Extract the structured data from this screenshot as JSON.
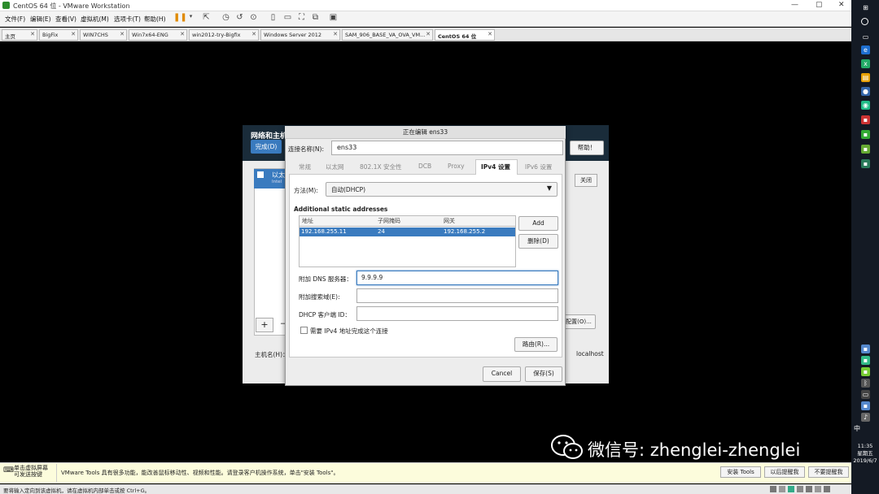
{
  "window": {
    "title": "CentOS 64 位 - VMware Workstation"
  },
  "menu": [
    "文件(F)",
    "编辑(E)",
    "查看(V)",
    "虚拟机(M)",
    "选项卡(T)",
    "帮助(H)"
  ],
  "tabs": [
    {
      "label": "主页",
      "active": false
    },
    {
      "label": "BigFix",
      "active": false
    },
    {
      "label": "WIN7CHS",
      "active": false
    },
    {
      "label": "Win7x64-ENG",
      "active": false
    },
    {
      "label": "win2012-try-Bigfix",
      "active": false
    },
    {
      "label": "Windows Server 2012",
      "active": false
    },
    {
      "label": "SAM_906_BASE_VA_OVA_VM...",
      "active": false
    },
    {
      "label": "CentOS 64 位",
      "active": true
    }
  ],
  "background_window": {
    "title": "网络和主机名",
    "done_label": "完成(D)",
    "help_label": "帮助！",
    "list_item": "以太",
    "list_item_sub": "Intel",
    "close_label": "关闭",
    "configure_label": "配置(O)...",
    "hostname_label": "主机名(H)：",
    "hostname_value": "localhost",
    "plus_label": "+",
    "minus_label": "−"
  },
  "dialog": {
    "title": "正在编辑 ens33",
    "conn_name_label": "连接名称(N):",
    "conn_name_value": "ens33",
    "tabs": [
      "常规",
      "以太网",
      "802.1X 安全性",
      "DCB",
      "Proxy",
      "IPv4 设置",
      "IPv6 设置"
    ],
    "active_tab": "IPv4 设置",
    "method_label": "方法(M):",
    "method_value": "自动(DHCP)",
    "addresses_heading": "Additional static addresses",
    "addr_columns": [
      "地址",
      "子网掩码",
      "网关"
    ],
    "addr_rows": [
      [
        "192.168.255.11",
        "24",
        "192.168.255.2"
      ]
    ],
    "add_label": "Add",
    "delete_label": "删除(D)",
    "dns_label": "附加 DNS 服务器：",
    "dns_value": "9.9.9.9",
    "search_label": "附加搜索域(E):",
    "search_value": "",
    "dhcp_label": "DHCP 客户端 ID：",
    "dhcp_value": "",
    "require_label": "需要 IPv4 地址完成这个连接",
    "require_checked": false,
    "routes_label": "路由(R)...",
    "cancel_label": "Cancel",
    "save_label": "保存(S)"
  },
  "watermark": "微信号: zhenglei-zhenglei",
  "notice": {
    "left_line1": "单击虚拟屏幕",
    "left_line2": "可发送按键",
    "message": "VMware Tools 具有很多功能，能改善鼠标移动性、视频和性能。请登录客户机操作系统，单击\"安装 Tools\"。",
    "install": "安装 Tools",
    "later": "以后提醒我",
    "never": "不要提醒我"
  },
  "status": "要将输入定向到该虚拟机，请在虚拟机内部单击或按 Ctrl+G。",
  "taskbar": {
    "ime": "中",
    "time": "11:35",
    "weekday": "星期五",
    "date": "2019/6/7"
  },
  "colors": {
    "accent": "#3a7bbf",
    "header": "#1a2c3a",
    "notice": "#fcfcdc"
  }
}
